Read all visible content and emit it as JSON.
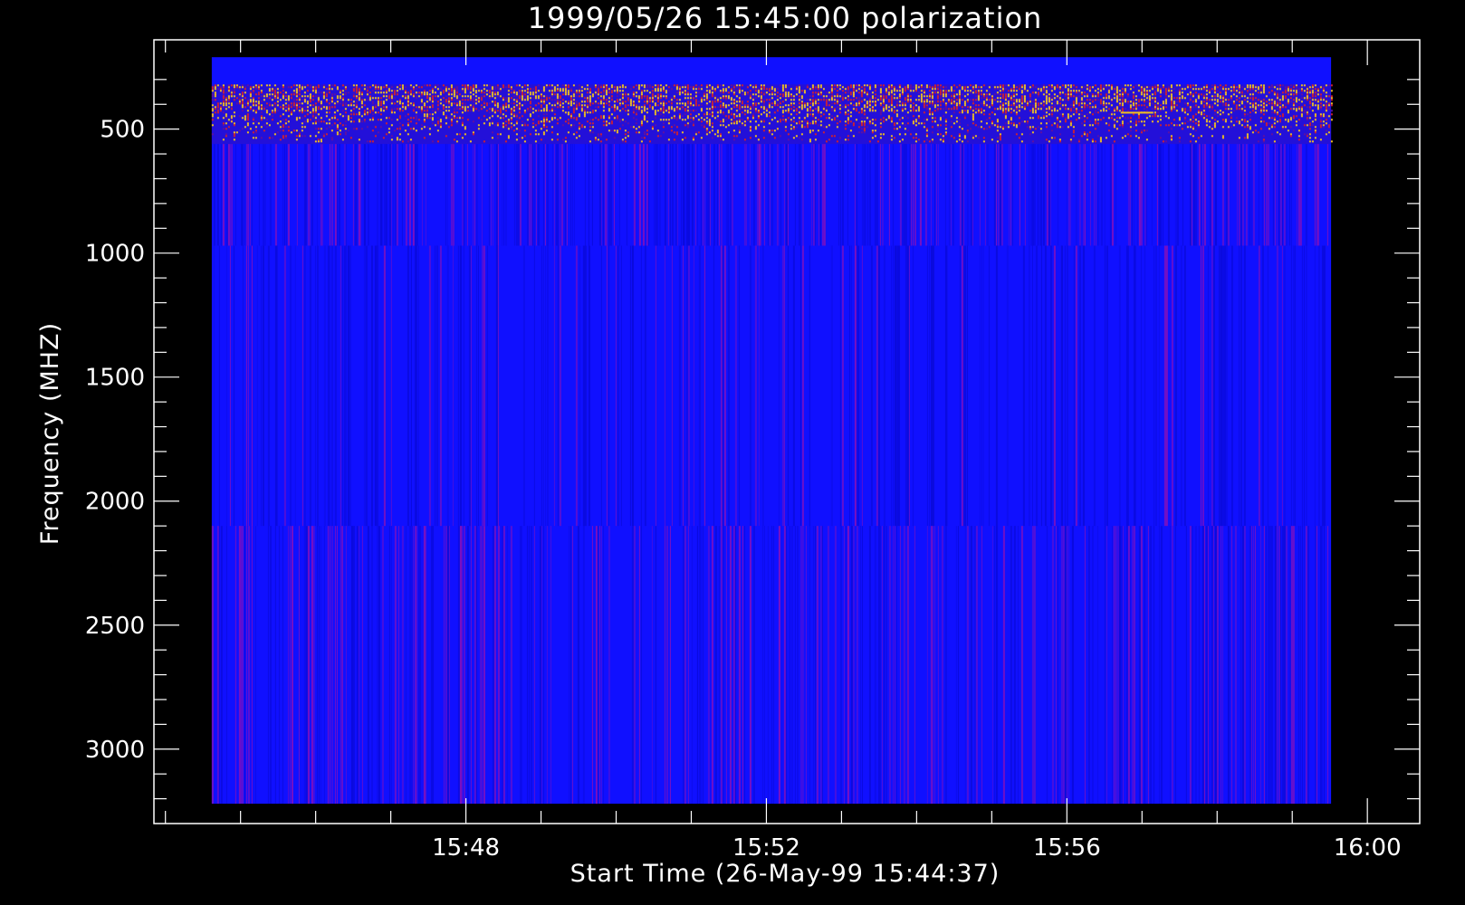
{
  "chart_data": {
    "type": "heatmap",
    "title": "1999/05/26 15:45:00 polarization",
    "xlabel": "Start Time (26-May-99 15:44:37)",
    "ylabel": "Frequency (MHZ)",
    "x_ticks": [
      {
        "label": "15:48",
        "minutes": 3.383
      },
      {
        "label": "15:52",
        "minutes": 7.383
      },
      {
        "label": "15:56",
        "minutes": 11.383
      },
      {
        "label": "16:00",
        "minutes": 15.383
      }
    ],
    "x_minor_tick_step_minutes": 1,
    "x_start_time": "15:44:37",
    "x_range_minutes": [
      -0.77,
      16.08
    ],
    "data_x_range_minutes": [
      0,
      14.9
    ],
    "y_ticks": [
      500,
      1000,
      1500,
      2000,
      2500,
      3000
    ],
    "y_minor_tick_step": 100,
    "ylim": [
      3300,
      140
    ],
    "y_inverted": true,
    "data_y_range": [
      210,
      3220
    ],
    "bands": [
      {
        "from": 210,
        "to": 320,
        "description": "uniform blue"
      },
      {
        "from": 320,
        "to": 560,
        "description": "high noise, yellow/red speckle"
      },
      {
        "from": 560,
        "to": 970,
        "description": "blue with red vertical striations"
      },
      {
        "from": 970,
        "to": 2100,
        "description": "blue, light striations"
      },
      {
        "from": 2100,
        "to": 3220,
        "description": "blue with red vertical striations"
      }
    ],
    "colors": {
      "background": "#000000",
      "base": "#1010ff",
      "stripe_dark": "#0a0ad8",
      "stripe_red": "#8a10b8",
      "noise_yellow": "#f0c020",
      "noise_red": "#d02030",
      "axis": "#ffffff"
    }
  }
}
